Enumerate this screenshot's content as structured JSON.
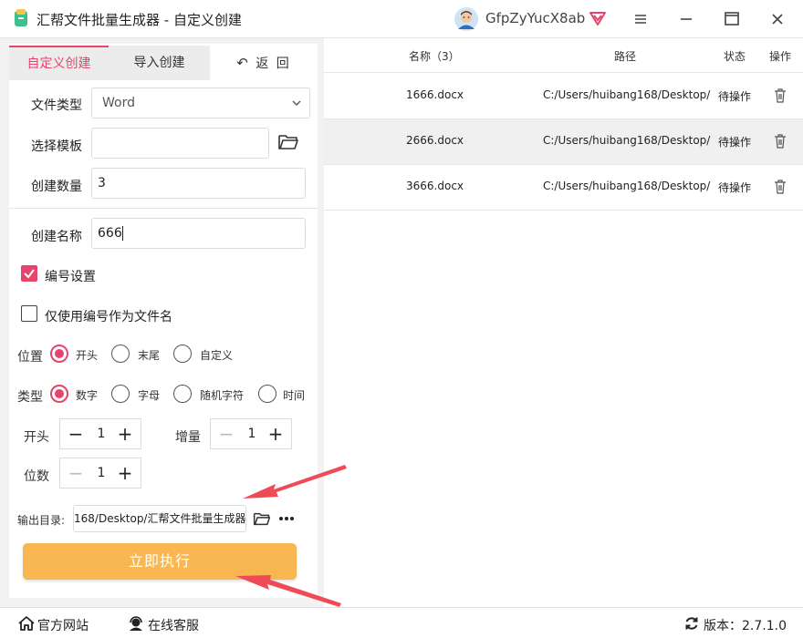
{
  "titlebar": {
    "title": "汇帮文件批量生成器 - 自定义创建",
    "username": "GfpZyYucX8ab"
  },
  "tabs": {
    "custom": "自定义创建",
    "import": "导入创建",
    "back": "返 回"
  },
  "form": {
    "file_type_label": "文件类型",
    "file_type_value": "Word",
    "template_label": "选择模板",
    "template_value": "",
    "count_label": "创建数量",
    "count_value": "3",
    "name_label": "创建名称",
    "name_value": "666",
    "numbering_label": "编号设置",
    "numbering_checked": true,
    "only_number_label": "仅使用编号作为文件名",
    "only_number_checked": false,
    "position_label": "位置",
    "position_options": [
      "开头",
      "末尾",
      "自定义"
    ],
    "position_selected": "开头",
    "type_label": "类型",
    "type_options": [
      "数字",
      "字母",
      "随机字符",
      "时间"
    ],
    "type_selected": "数字",
    "start_label": "开头",
    "start_value": "1",
    "increment_label": "增量",
    "increment_value": "1",
    "digits_label": "位数",
    "digits_value": "1",
    "output_label": "输出目录:",
    "output_value": "168/Desktop/汇帮文件批量生成器",
    "run_label": "立即执行"
  },
  "table": {
    "headers": {
      "name": "名称（3）",
      "path": "路径",
      "status": "状态",
      "action": "操作"
    },
    "rows": [
      {
        "name": "1666.docx",
        "path": "C:/Users/huibang168/Desktop/",
        "status": "待操作"
      },
      {
        "name": "2666.docx",
        "path": "C:/Users/huibang168/Desktop/",
        "status": "待操作"
      },
      {
        "name": "3666.docx",
        "path": "C:/Users/huibang168/Desktop/",
        "status": "待操作"
      }
    ]
  },
  "bottombar": {
    "website": "官方网站",
    "support": "在线客服",
    "version": "版本：2.7.1.0"
  },
  "colors": {
    "accent": "#e6436d",
    "run_button": "#f8b751",
    "annotation_arrow": "#ee4b57"
  }
}
